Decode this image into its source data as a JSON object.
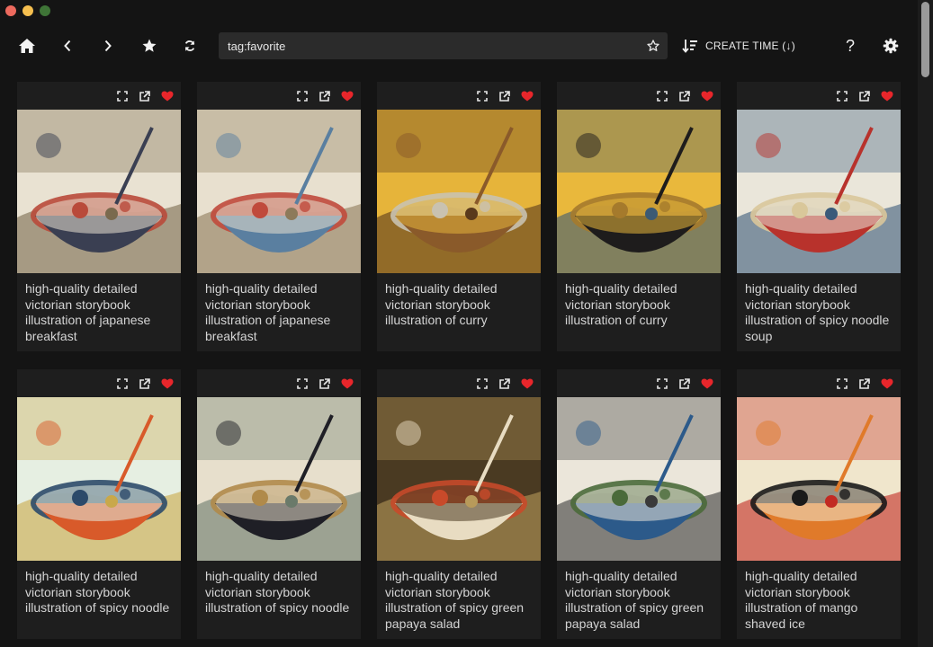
{
  "toolbar": {
    "search_value": "tag:favorite",
    "sort_label": "CREATE TIME (↓)",
    "icons": [
      "home-icon",
      "back-icon",
      "forward-icon",
      "favorites-icon",
      "refresh-icon",
      "star-outline-icon",
      "sort-icon",
      "help-icon",
      "gear-icon"
    ],
    "help_label": "?"
  },
  "colors": {
    "background": "#141414",
    "card": "#1e1e1e",
    "heart": "#e8262b",
    "search_bg": "#2b2b2b"
  },
  "cards": [
    {
      "caption": "high-quality detailed victorian storybook illustration of japanese breakfast",
      "favorite": true,
      "palette": [
        "#e9e2d2",
        "#3a3f52",
        "#b94a3a",
        "#7a6a4e"
      ]
    },
    {
      "caption": "high-quality detailed victorian storybook illustration of japanese breakfast",
      "favorite": true,
      "palette": [
        "#e8e0cf",
        "#5a7fa0",
        "#c04a3c",
        "#8d7a5a"
      ]
    },
    {
      "caption": "high-quality detailed victorian storybook illustration of curry",
      "favorite": true,
      "palette": [
        "#e6b43a",
        "#8a5a2a",
        "#c9c2b0",
        "#5a3a1c"
      ]
    },
    {
      "caption": "high-quality detailed victorian storybook illustration of curry",
      "favorite": true,
      "palette": [
        "#e9b83c",
        "#1e1c1c",
        "#a57a2c",
        "#3c5a74"
      ]
    },
    {
      "caption": "high-quality detailed victorian storybook illustration of spicy noodle soup",
      "favorite": true,
      "palette": [
        "#eae6da",
        "#b8322c",
        "#d9c79a",
        "#3a5a7a"
      ]
    },
    {
      "caption": "high-quality detailed victorian storybook illustration of spicy noodle",
      "favorite": true,
      "palette": [
        "#e6efe2",
        "#d85a2a",
        "#2c4a6a",
        "#c9a84a"
      ]
    },
    {
      "caption": "high-quality detailed victorian storybook illustration of spicy noodle",
      "favorite": true,
      "palette": [
        "#e7dfcc",
        "#1f1f26",
        "#b08a4a",
        "#6a7a6a"
      ]
    },
    {
      "caption": "high-quality detailed victorian storybook illustration of spicy green papaya salad",
      "favorite": true,
      "palette": [
        "#4a3a22",
        "#e8dcc2",
        "#c84a2a",
        "#b89a5a"
      ]
    },
    {
      "caption": "high-quality detailed victorian storybook illustration of spicy green papaya salad",
      "favorite": true,
      "palette": [
        "#ebe6da",
        "#2c5a8a",
        "#4a6a3a",
        "#3a3a3a"
      ]
    },
    {
      "caption": "high-quality detailed victorian storybook illustration of mango shaved ice",
      "favorite": true,
      "palette": [
        "#f0e6cc",
        "#e07a2a",
        "#1a1a1a",
        "#c22a22"
      ]
    }
  ]
}
